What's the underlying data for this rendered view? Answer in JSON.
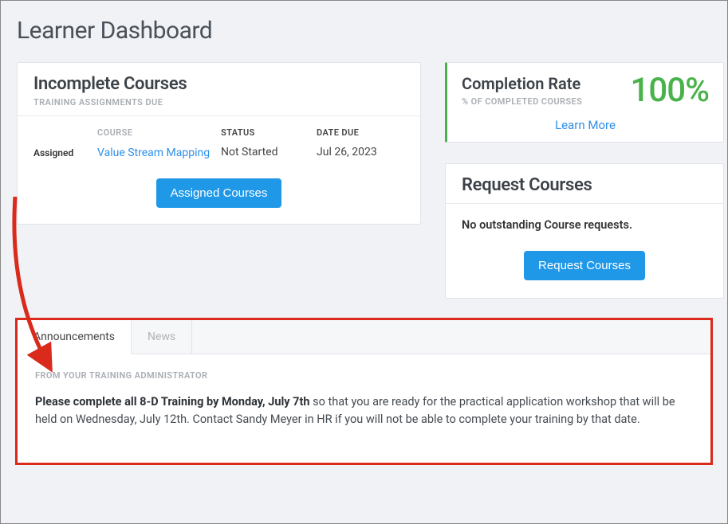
{
  "page_title": "Learner Dashboard",
  "incomplete": {
    "title": "Incomplete Courses",
    "subtitle": "TRAINING ASSIGNMENTS DUE",
    "columns": {
      "course": "COURSE",
      "status": "STATUS",
      "date": "DATE DUE"
    },
    "rows": [
      {
        "badge": "Assigned",
        "course": "Value Stream Mapping",
        "status": "Not Started",
        "date": "Jul 26, 2023"
      }
    ],
    "button": "Assigned Courses"
  },
  "completion": {
    "title": "Completion Rate",
    "subtitle": "% OF COMPLETED COURSES",
    "value": "100%",
    "link": "Learn More"
  },
  "request": {
    "title": "Request Courses",
    "body": "No outstanding Course requests.",
    "button": "Request Courses"
  },
  "tabs": {
    "announcements_label": "Announcements",
    "news_label": "News",
    "subtitle": "FROM YOUR TRAINING ADMINISTRATOR",
    "announcement_bold": "Please complete all 8-D Training by Monday, July 7th",
    "announcement_rest": " so that you are ready for the practical application workshop that will be held on Wednesday, July 12th. Contact Sandy Meyer in HR if you will not be able to complete your training by that date."
  }
}
